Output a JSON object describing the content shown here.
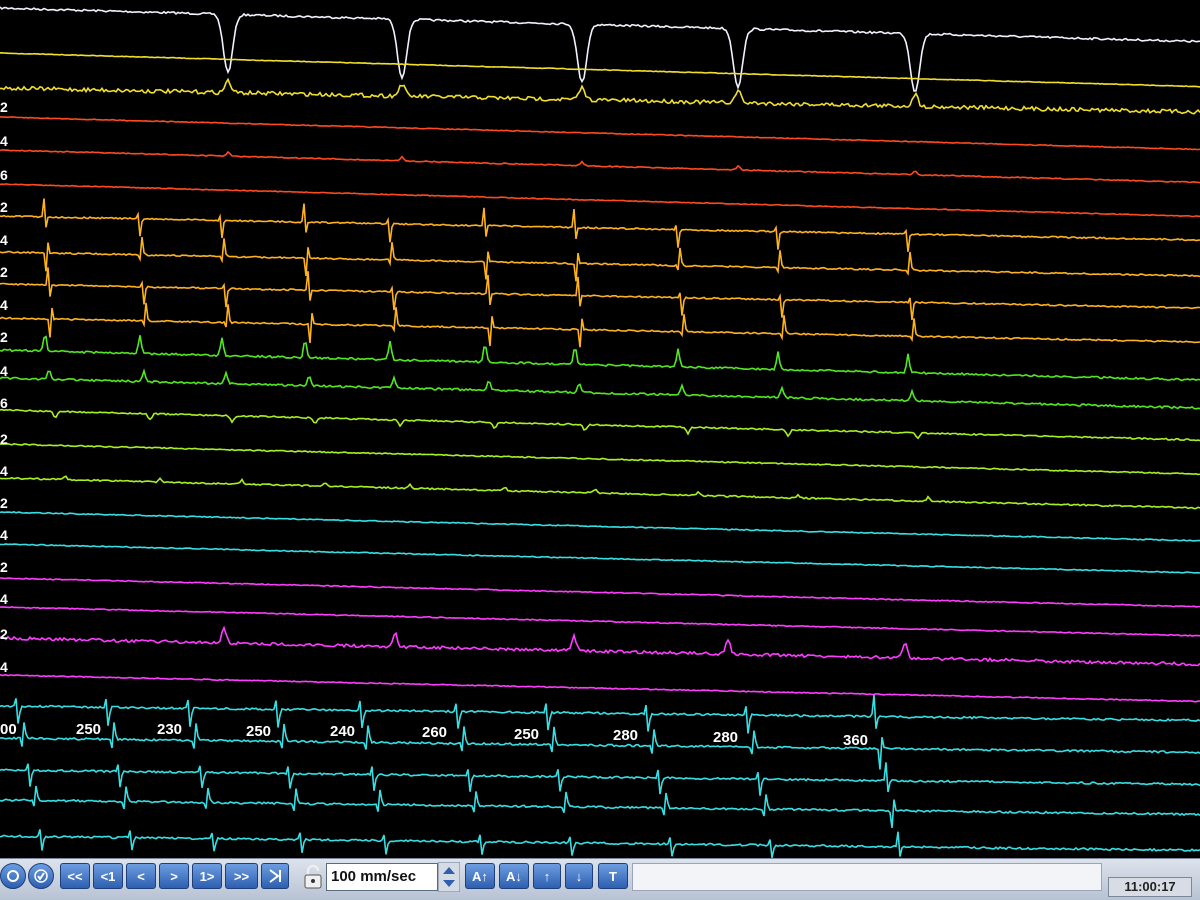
{
  "channel_labels": [
    "2",
    "4",
    "6",
    "2",
    "4",
    "2",
    "4",
    "2",
    "4",
    "6",
    "2",
    "4",
    "2",
    "4",
    "2",
    "4",
    "2",
    "4"
  ],
  "cycle_lengths": [
    "00",
    "250",
    "230",
    "250",
    "240",
    "260",
    "250",
    "280",
    "280",
    "360"
  ],
  "toolbar": {
    "btn_first": "<<",
    "btn_prev_1": "<1",
    "btn_prev": "<",
    "btn_next": ">",
    "btn_next_1": "1>",
    "btn_last": ">>",
    "btn_end": "K",
    "btn_amp_up": "A↑",
    "btn_amp_down": "A↓",
    "btn_up": "↑",
    "btn_down": "↓",
    "btn_t": "T",
    "sweep_speed": "100 mm/sec"
  },
  "clock": "11:00:17",
  "colors": {
    "white": "#f2f2ff",
    "yellow": "#f0e028",
    "orange_red": "#ff4a1e",
    "orange": "#ffb21c",
    "green": "#52e81e",
    "yellow_green": "#a8f020",
    "cyan": "#34e0e4",
    "magenta": "#ff3cff"
  }
}
